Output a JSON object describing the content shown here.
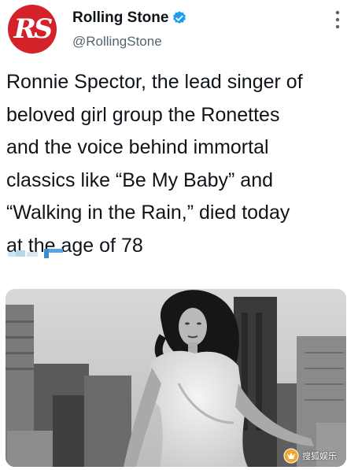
{
  "author": {
    "display_name": "Rolling Stone",
    "handle": "@RollingStone",
    "avatar_text": "RS",
    "avatar_icon": "rolling-stone-logo",
    "verified_icon": "verified-badge-icon",
    "brand_color": "#d3222a",
    "verified_color": "#1d9bf0"
  },
  "more_icon": "more-vertical-icon",
  "tweet": {
    "text": "Ronnie Spector, the lead singer of\nbeloved girl group the Ronettes\nand the voice behind immortal\nclassics like “Be My Baby” and\n“Walking in the Rain,” died today\nat the age of 78"
  },
  "media": {
    "image_icon": "photo-image",
    "style": "black-and-white"
  },
  "watermark": {
    "icon": "sohu-fox-icon",
    "text": "搜狐娱乐"
  }
}
